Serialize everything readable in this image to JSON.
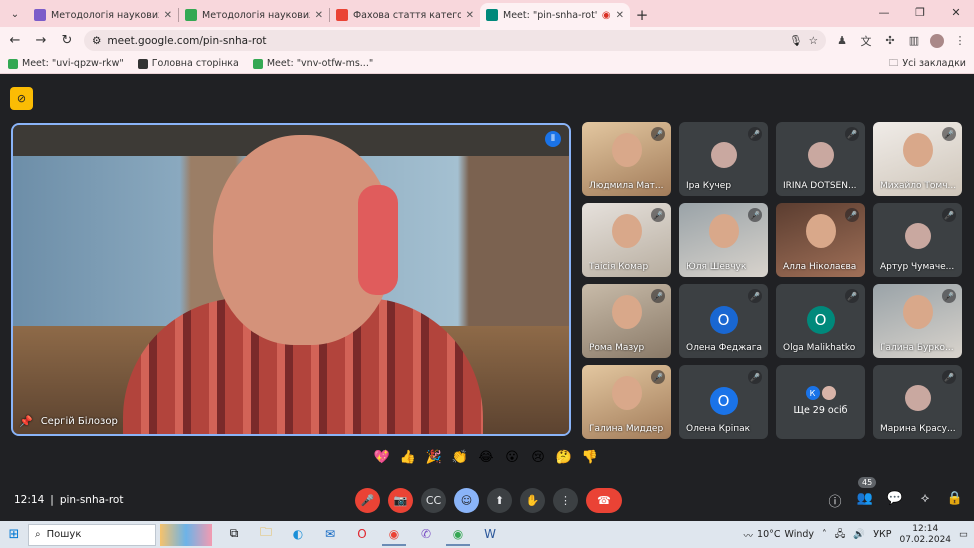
{
  "tabs": [
    {
      "title": "Методологія наукових дослід",
      "color": "#7b5cc9",
      "active": false
    },
    {
      "title": "Методологія наукових дослід",
      "color": "#34a853",
      "active": false
    },
    {
      "title": "Фахова стаття категорії Б (спе",
      "color": "#ea4335",
      "active": false
    },
    {
      "title": "Meet: \"pin-snha-rot\"",
      "color": "#00897b",
      "active": true
    }
  ],
  "address": {
    "url": "meet.google.com/pin-snha-rot"
  },
  "bookmarks": [
    {
      "label": "Meet: \"uvi-qpzw-rkw\""
    },
    {
      "label": "Головна сторінка"
    },
    {
      "label": "Meet: \"vnv-otfw-ms...\""
    }
  ],
  "bookmarks_all": "Усі закладки",
  "main_speaker": {
    "name": "Сергій Білозор"
  },
  "participants": [
    {
      "name": "Людмила Мат...",
      "type": "video",
      "style": "v5"
    },
    {
      "name": "Іра Кучер",
      "type": "avatar",
      "style": ""
    },
    {
      "name": "IRINA DOTSEN...",
      "type": "avatar",
      "style": ""
    },
    {
      "name": "Михайло Томч...",
      "type": "video",
      "style": "v6"
    },
    {
      "name": "Таісія Комар",
      "type": "video",
      "style": "v2"
    },
    {
      "name": "Юля Шевчук",
      "type": "video",
      "style": "v4"
    },
    {
      "name": "Алла Ніколаєва",
      "type": "video",
      "style": "v3"
    },
    {
      "name": "Артур Чумаче...",
      "type": "avatar",
      "style": ""
    },
    {
      "name": "Рома Мазур",
      "type": "video",
      "style": "video"
    },
    {
      "name": "Олена Феджага",
      "type": "letter",
      "letter": "О",
      "color": "#1967d2"
    },
    {
      "name": "Olga Malikhatko",
      "type": "letter",
      "letter": "O",
      "color": "#00897b"
    },
    {
      "name": "Галина Бурко...",
      "type": "video",
      "style": "v4"
    },
    {
      "name": "Галина Миддер",
      "type": "video",
      "style": "v5"
    },
    {
      "name": "Олена Кріпак",
      "type": "letter",
      "letter": "О",
      "color": "#1a73e8"
    },
    {
      "name": "Ще 29 осіб",
      "type": "more",
      "mini": "К"
    },
    {
      "name": "Марина Красу...",
      "type": "avatar",
      "style": ""
    }
  ],
  "reactions": [
    "💖",
    "👍",
    "🎉",
    "👏",
    "😂",
    "😮",
    "😢",
    "🤔",
    "👎"
  ],
  "footer": {
    "time": "12:14",
    "code": "pin-snha-rot",
    "people_count": "45"
  },
  "taskbar": {
    "search_label": "Пошук",
    "temperature": "10°C",
    "weather": "Windy",
    "lang": "УКР",
    "time": "12:14",
    "date": "07.02.2024"
  }
}
